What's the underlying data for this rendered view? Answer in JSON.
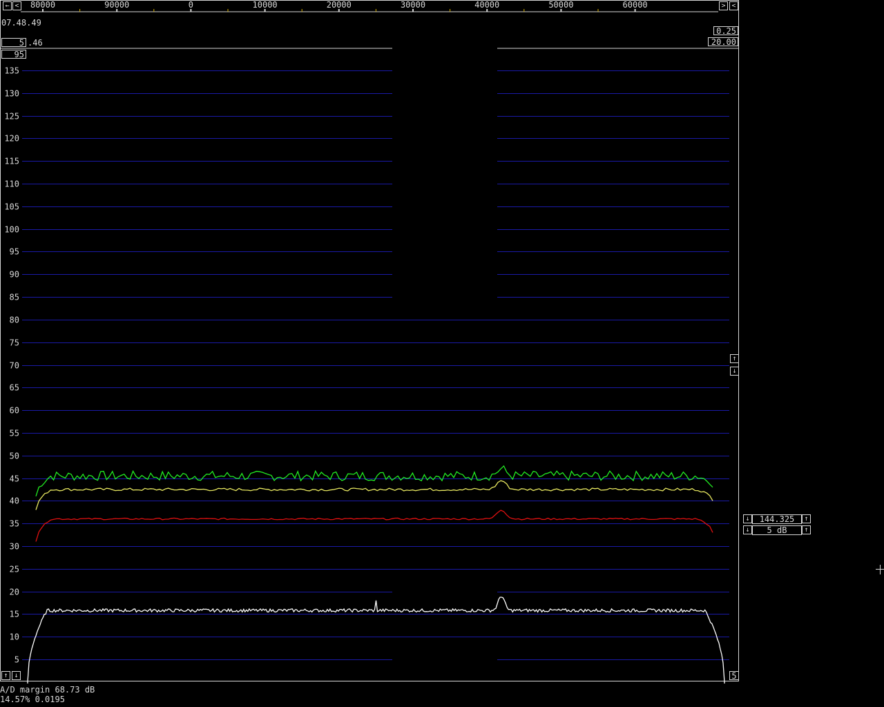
{
  "header": {
    "time": "07.48.49",
    "avg_box": "5",
    "avg_suffix": ".46",
    "top_box": "95",
    "right_box_1": "0.25",
    "right_box_2": "20.00"
  },
  "freq_scale": {
    "labels": [
      "80000",
      "90000",
      "0",
      "10000",
      "20000",
      "30000",
      "40000",
      "50000",
      "60000"
    ]
  },
  "side_controls": {
    "freq_value": "144.325",
    "gain_value": "5 dB"
  },
  "corner_label": "5",
  "status": {
    "line1": "A/D margin 68.73 dB",
    "line2": "14.57% 0.0195"
  },
  "icons": {
    "left_arrow": "arrow-left-icon",
    "right_arrow": "arrow-right-icon",
    "up_arrow": "arrow-up-icon",
    "down_arrow": "arrow-down-icon"
  },
  "colors": {
    "grid": "#1a1aa8",
    "trace_green": "#22ee22",
    "trace_yellow": "#e8e860",
    "trace_red": "#e01010",
    "trace_white": "#ffffff"
  },
  "chart_data": {
    "type": "line",
    "y_ticks": [
      5,
      10,
      15,
      20,
      25,
      30,
      35,
      40,
      45,
      50,
      55,
      60,
      65,
      70,
      75,
      80,
      85,
      90,
      95,
      100,
      105,
      110,
      115,
      120,
      125,
      130,
      135
    ],
    "ylim": [
      0,
      138
    ],
    "series": [
      {
        "color": "green",
        "level": 45.5,
        "start": 41,
        "end": 43,
        "peak": 47,
        "noise": 0.9
      },
      {
        "color": "yellow",
        "level": 42.5,
        "start": 38,
        "end": 40,
        "peak": 44.5,
        "noise": 0.25
      },
      {
        "color": "red",
        "level": 36,
        "start": 31,
        "end": 33,
        "peak": 38,
        "noise": 0.15
      },
      {
        "color": "white",
        "level": 15.8,
        "start": 0,
        "end": 0,
        "peak": 19,
        "noise": 0.35
      }
    ]
  }
}
